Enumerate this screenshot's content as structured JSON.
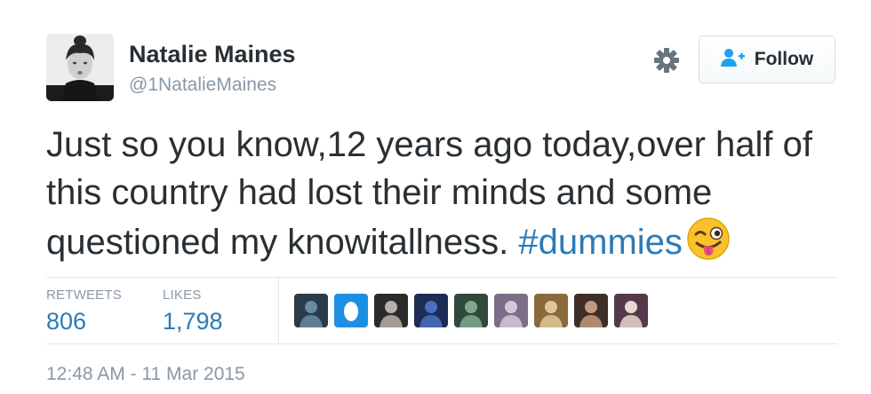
{
  "profile": {
    "display_name": "Natalie Maines",
    "handle": "@1NatalieMaines"
  },
  "header": {
    "follow_label": "Follow",
    "gear_icon": "gear-icon",
    "follow_icon": "add-user-icon"
  },
  "tweet": {
    "text": "Just so you know,12 years ago today,over half of this country had lost their minds and some questioned my knowitallness.",
    "hashtag": "#dummies",
    "emoji": "winking-face-with-tongue"
  },
  "stats": {
    "retweets_label": "RETWEETS",
    "retweets_count": "806",
    "likes_label": "LIKES",
    "likes_count": "1,798"
  },
  "likers": [
    {
      "name": "liker-avatar-1",
      "colors": [
        "#2a3b4a",
        "#6b8aa0"
      ]
    },
    {
      "name": "liker-avatar-2",
      "colors": [
        "#1d8fe0",
        "#ffffff"
      ]
    },
    {
      "name": "liker-avatar-3",
      "colors": [
        "#2b2b2b",
        "#b9b1a8"
      ]
    },
    {
      "name": "liker-avatar-4",
      "colors": [
        "#1c2c55",
        "#4a6fc2"
      ]
    },
    {
      "name": "liker-avatar-5",
      "colors": [
        "#2f4a3b",
        "#7ea98f"
      ]
    },
    {
      "name": "liker-avatar-6",
      "colors": [
        "#7a6f86",
        "#d6c8d9"
      ]
    },
    {
      "name": "liker-avatar-7",
      "colors": [
        "#8a6a3c",
        "#e0c79a"
      ]
    },
    {
      "name": "liker-avatar-8",
      "colors": [
        "#3f2e28",
        "#c39a7e"
      ]
    },
    {
      "name": "liker-avatar-9",
      "colors": [
        "#55384a",
        "#e9d6cf"
      ]
    }
  ],
  "footer": {
    "timestamp": "12:48 AM - 11 Mar 2015"
  },
  "colors": {
    "link": "#2b7bb9",
    "text": "#292f33",
    "muted": "#8899a6",
    "divider": "#e1e8ed"
  }
}
